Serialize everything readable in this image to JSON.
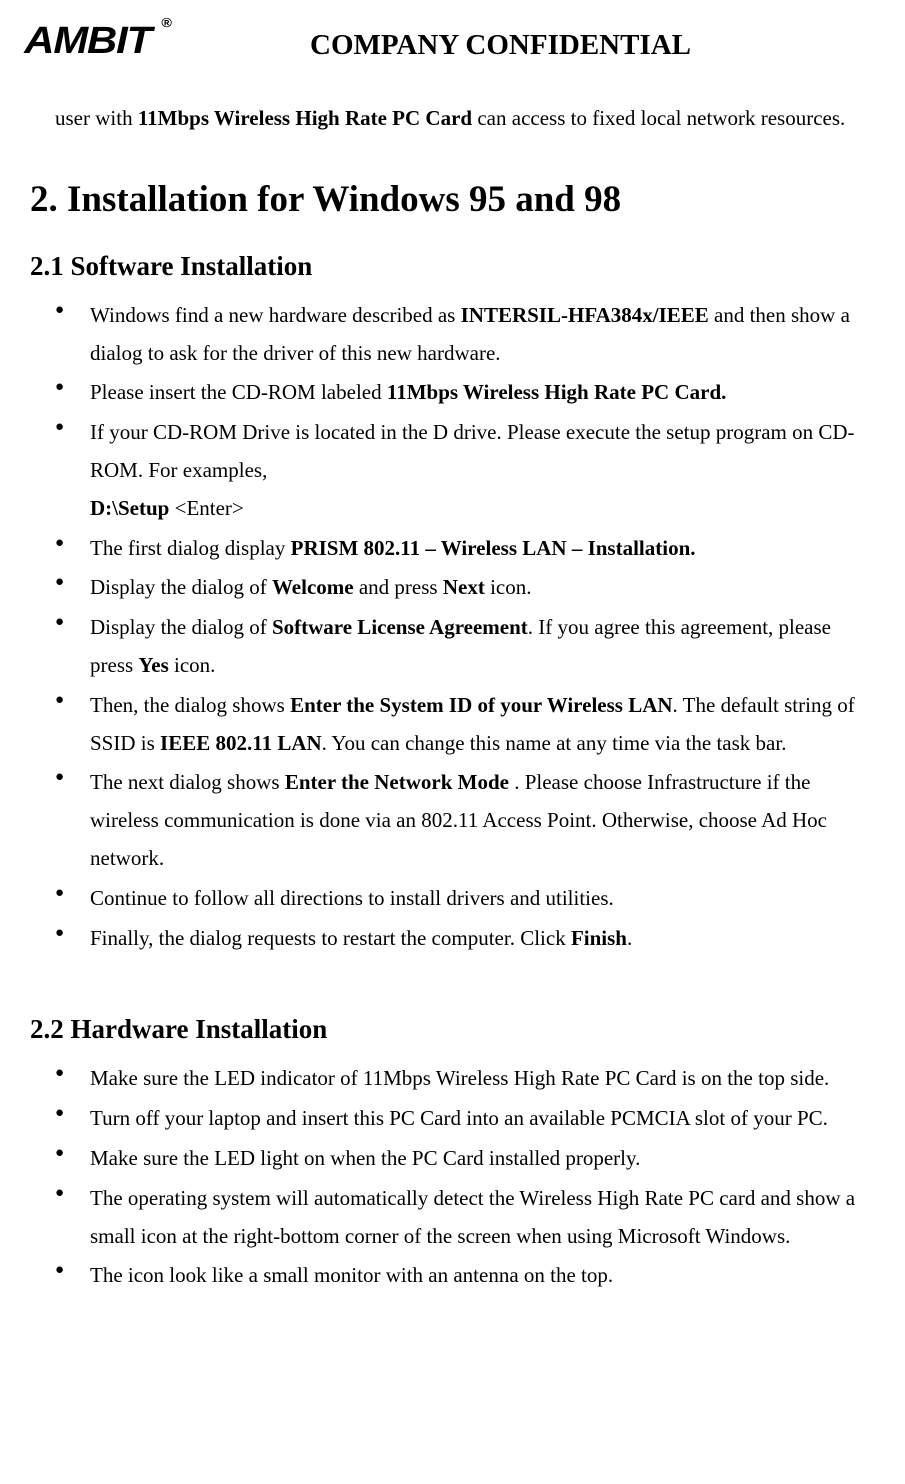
{
  "header": {
    "logo_text": "AMBIT",
    "logo_reg": "®",
    "confidential": "COMPANY CONFIDENTIAL"
  },
  "intro": {
    "prefix": "user with ",
    "bold": "11Mbps Wireless High Rate PC Card",
    "suffix": " can access to fixed local network resources."
  },
  "section2": {
    "title": "2. Installation for Windows 95 and 98"
  },
  "section21": {
    "title": "2.1 Software Installation",
    "items": {
      "i1a": "Windows find a new hardware described as ",
      "i1b": "INTERSIL-HFA384x/IEEE",
      "i1c": " and then show a dialog to ask for the driver of this new hardware.",
      "i2a": "Please insert the CD-ROM labeled ",
      "i2b": "11Mbps Wireless High Rate PC Card.",
      "i3a": "If your CD-ROM Drive is located in the D drive. Please execute the setup program on CD-ROM. For examples,",
      "i3sub_b": "D:\\Setup ",
      "i3sub_r": "<Enter>",
      "i4a": "The first dialog display ",
      "i4b": "PRISM 802.11 – Wireless LAN – Installation.",
      "i5a": "Display the dialog of ",
      "i5b": "Welcome",
      "i5c": " and press ",
      "i5d": "Next",
      "i5e": " icon.",
      "i6a": "Display the dialog of ",
      "i6b": "Software License Agreement",
      "i6c": ". If you agree this agreement, please press ",
      "i6d": "Yes",
      "i6e": " icon.",
      "i7a": "Then, the dialog shows ",
      "i7b": "Enter the System ID of your Wireless LAN",
      "i7c": ". The default string of SSID is ",
      "i7d": "IEEE 802.11 LAN",
      "i7e": ". You can change this name at any time via the task bar.",
      "i8a": "The next dialog shows ",
      "i8b": "Enter the Network Mode",
      "i8c": " . Please choose Infrastructure if the wireless communication is done via an 802.11 Access Point. Otherwise, choose Ad Hoc network.",
      "i9": "Continue to follow all directions to install drivers and utilities.",
      "i10a": "Finally, the dialog requests to restart the computer. Click ",
      "i10b": "Finish",
      "i10c": "."
    }
  },
  "section22": {
    "title": "2.2 Hardware Installation",
    "items": {
      "h1": "Make sure the LED indicator of 11Mbps Wireless High Rate PC Card is on the top side.",
      "h2": "Turn off your laptop and insert this PC Card into an available PCMCIA slot of your PC.",
      "h3": "Make sure the LED light on when the PC Card installed properly.",
      "h4": "The operating system will automatically detect the Wireless High Rate PC card and show a small icon at the right-bottom corner of the screen when using Microsoft Windows.",
      "h5": "The icon look like a small monitor with an antenna on the top."
    }
  }
}
